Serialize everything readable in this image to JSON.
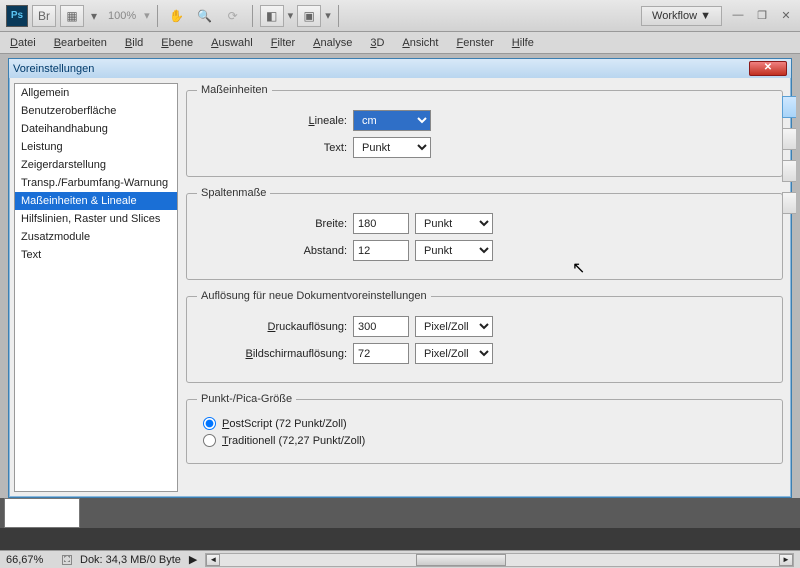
{
  "toolbar": {
    "zoom": "100%",
    "workflow": "Workflow ▼"
  },
  "menu": [
    "Datei",
    "Bearbeiten",
    "Bild",
    "Ebene",
    "Auswahl",
    "Filter",
    "Analyse",
    "3D",
    "Ansicht",
    "Fenster",
    "Hilfe"
  ],
  "dialog": {
    "title": "Voreinstellungen",
    "sidebar": [
      "Allgemein",
      "Benutzeroberfläche",
      "Dateihandhabung",
      "Leistung",
      "Zeigerdarstellung",
      "Transp./Farbumfang-Warnung",
      "Maßeinheiten & Lineale",
      "Hilfslinien, Raster und Slices",
      "Zusatzmodule",
      "Text"
    ],
    "selected": 6,
    "units": {
      "legend": "Maßeinheiten",
      "rulers_lbl": "Lineale:",
      "rulers_val": "cm",
      "text_lbl": "Text:",
      "text_val": "Punkt"
    },
    "cols": {
      "legend": "Spaltenmaße",
      "width_lbl": "Breite:",
      "width_val": "180",
      "width_unit": "Punkt",
      "gap_lbl": "Abstand:",
      "gap_val": "12",
      "gap_unit": "Punkt"
    },
    "res": {
      "legend": "Auflösung für neue Dokumentvoreinstellungen",
      "print_lbl": "Druckauflösung:",
      "print_val": "300",
      "print_unit": "Pixel/Zoll",
      "screen_lbl": "Bildschirmauflösung:",
      "screen_val": "72",
      "screen_unit": "Pixel/Zoll"
    },
    "pica": {
      "legend": "Punkt-/Pica-Größe",
      "ps": "PostScript (72 Punkt/Zoll)",
      "trad": "Traditionell (72,27 Punkt/Zoll)"
    }
  },
  "status": {
    "zoom": "66,67%",
    "doc": "Dok: 34,3 MB/0 Byte"
  }
}
